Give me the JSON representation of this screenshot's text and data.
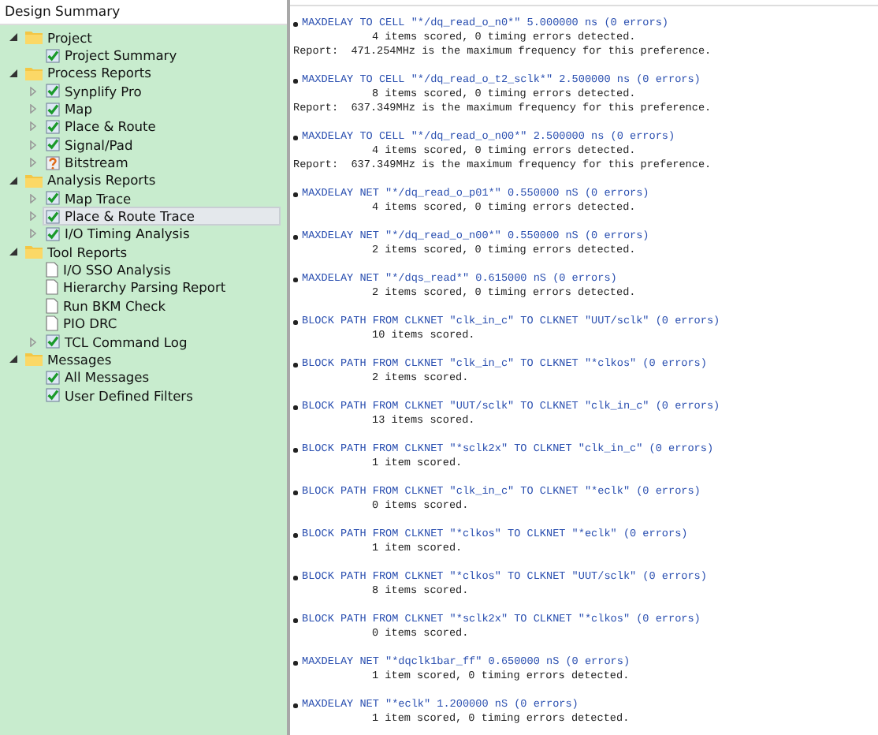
{
  "sidebar": {
    "title": "Design Summary",
    "items": [
      {
        "label": "Project",
        "kind": "folder",
        "expanded": true,
        "selected": false,
        "children": [
          {
            "label": "Project Summary",
            "kind": "check",
            "selected": false
          }
        ]
      },
      {
        "label": "Process Reports",
        "kind": "folder",
        "expanded": true,
        "selected": false,
        "children": [
          {
            "label": "Synplify Pro",
            "kind": "check",
            "expanded": false,
            "selected": false
          },
          {
            "label": "Map",
            "kind": "check",
            "expanded": false,
            "selected": false
          },
          {
            "label": "Place & Route",
            "kind": "check",
            "expanded": false,
            "selected": false
          },
          {
            "label": "Signal/Pad",
            "kind": "check",
            "expanded": false,
            "selected": false
          },
          {
            "label": "Bitstream",
            "kind": "question",
            "expanded": false,
            "selected": false
          }
        ]
      },
      {
        "label": "Analysis Reports",
        "kind": "folder",
        "expanded": true,
        "selected": false,
        "children": [
          {
            "label": "Map Trace",
            "kind": "check",
            "expanded": false,
            "selected": false
          },
          {
            "label": "Place & Route Trace",
            "kind": "check",
            "expanded": false,
            "selected": true
          },
          {
            "label": "I/O Timing Analysis",
            "kind": "check",
            "expanded": false,
            "selected": false
          }
        ]
      },
      {
        "label": "Tool Reports",
        "kind": "folder",
        "expanded": true,
        "selected": false,
        "children": [
          {
            "label": "I/O SSO Analysis",
            "kind": "doc",
            "selected": false
          },
          {
            "label": "Hierarchy Parsing Report",
            "kind": "doc",
            "selected": false
          },
          {
            "label": "Run BKM Check",
            "kind": "doc",
            "selected": false
          },
          {
            "label": "PIO DRC",
            "kind": "doc",
            "selected": false
          },
          {
            "label": "TCL Command Log",
            "kind": "check",
            "expanded": false,
            "selected": false
          }
        ]
      },
      {
        "label": "Messages",
        "kind": "folder",
        "expanded": true,
        "selected": false,
        "children": [
          {
            "label": "All Messages",
            "kind": "check",
            "selected": false
          },
          {
            "label": "User Defined Filters",
            "kind": "check",
            "selected": false
          }
        ]
      }
    ]
  },
  "report": [
    {
      "header": "MAXDELAY TO CELL \"*/dq_read_o_n0*\" 5.000000 ns (0 errors)",
      "detail": "4 items scored, 0 timing errors detected.",
      "note": "Report:  471.254MHz is the maximum frequency for this preference."
    },
    {
      "header": "MAXDELAY TO CELL \"*/dq_read_o_t2_sclk*\" 2.500000 ns (0 errors)",
      "detail": "8 items scored, 0 timing errors detected.",
      "note": "Report:  637.349MHz is the maximum frequency for this preference."
    },
    {
      "header": "MAXDELAY TO CELL \"*/dq_read_o_n00*\" 2.500000 ns (0 errors)",
      "detail": "4 items scored, 0 timing errors detected.",
      "note": "Report:  637.349MHz is the maximum frequency for this preference."
    },
    {
      "header": "MAXDELAY NET \"*/dq_read_o_p01*\" 0.550000 nS (0 errors)",
      "detail": "4 items scored, 0 timing errors detected."
    },
    {
      "header": "MAXDELAY NET \"*/dq_read_o_n00*\" 0.550000 nS (0 errors)",
      "detail": "2 items scored, 0 timing errors detected."
    },
    {
      "header": "MAXDELAY NET \"*/dqs_read*\" 0.615000 nS (0 errors)",
      "detail": "2 items scored, 0 timing errors detected."
    },
    {
      "header": "BLOCK PATH FROM CLKNET \"clk_in_c\" TO CLKNET \"UUT/sclk\" (0 errors)",
      "detail": "10 items scored."
    },
    {
      "header": "BLOCK PATH FROM CLKNET \"clk_in_c\" TO CLKNET \"*clkos\" (0 errors)",
      "detail": "2 items scored."
    },
    {
      "header": "BLOCK PATH FROM CLKNET \"UUT/sclk\" TO CLKNET \"clk_in_c\" (0 errors)",
      "detail": "13 items scored."
    },
    {
      "header": "BLOCK PATH FROM CLKNET \"*sclk2x\" TO CLKNET \"clk_in_c\" (0 errors)",
      "detail": "1 item scored."
    },
    {
      "header": "BLOCK PATH FROM CLKNET \"clk_in_c\" TO CLKNET \"*eclk\" (0 errors)",
      "detail": "0 items scored."
    },
    {
      "header": "BLOCK PATH FROM CLKNET \"*clkos\" TO CLKNET \"*eclk\" (0 errors)",
      "detail": "1 item scored."
    },
    {
      "header": "BLOCK PATH FROM CLKNET \"*clkos\" TO CLKNET \"UUT/sclk\" (0 errors)",
      "detail": "8 items scored."
    },
    {
      "header": "BLOCK PATH FROM CLKNET \"*sclk2x\" TO CLKNET \"*clkos\" (0 errors)",
      "detail": "0 items scored."
    },
    {
      "header": "MAXDELAY NET \"*dqclk1bar_ff\" 0.650000 nS (0 errors)",
      "detail": "1 item scored, 0 timing errors detected."
    },
    {
      "header": "MAXDELAY NET \"*eclk\" 1.200000 nS (0 errors)",
      "detail": "1 item scored, 0 timing errors detected."
    }
  ]
}
